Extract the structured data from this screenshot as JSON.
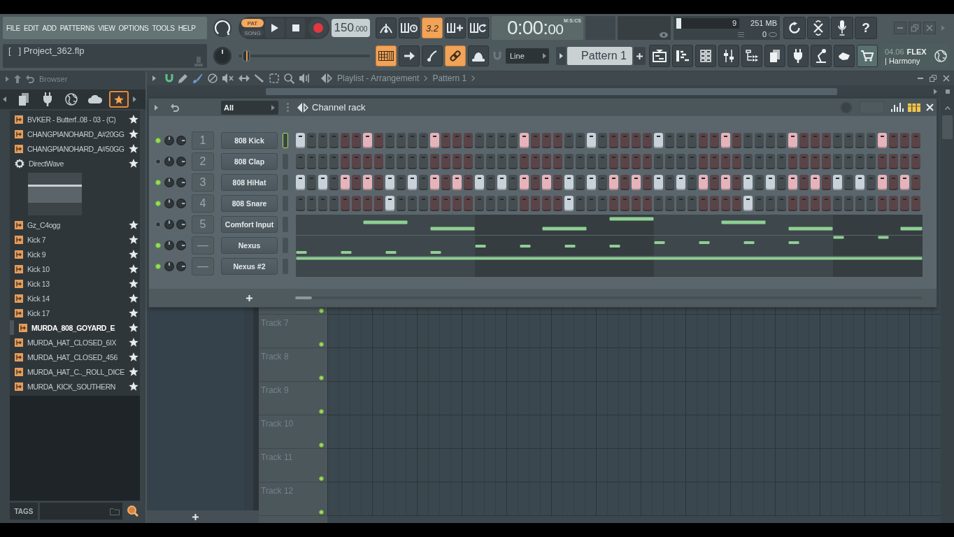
{
  "menu": [
    "FILE",
    "EDIT",
    "ADD",
    "PATTERNS",
    "VIEW",
    "OPTIONS",
    "TOOLS",
    "HELP"
  ],
  "project": {
    "title": "[   ] Project_362.flp"
  },
  "transport": {
    "modes": [
      {
        "label": "PAT",
        "selected": true
      },
      {
        "label": "SONG",
        "selected": false
      }
    ]
  },
  "tempo": {
    "whole": "150",
    "fraction": ".000"
  },
  "record_options": [
    {
      "kind": "metronome",
      "on": false
    },
    {
      "kind": "wait",
      "on": false
    },
    {
      "kind": "countdown",
      "label": "3.2",
      "on": true
    },
    {
      "kind": "stepedit",
      "on": false
    },
    {
      "kind": "loop",
      "on": false
    }
  ],
  "time": {
    "value": "0:00:",
    "centiseconds": "00",
    "unit": "M:S:CS"
  },
  "monitor": {
    "cpu": {
      "level": 0.08,
      "reading": "9"
    },
    "memory": "251 MB",
    "polyphony": "0"
  },
  "help": {
    "label": "?"
  },
  "master_pitch": {
    "level": 0.06
  },
  "edit_options": [
    {
      "kind": "keyboard",
      "on": true
    },
    {
      "kind": "arrow",
      "on": false
    },
    {
      "kind": "curve",
      "on": false
    },
    {
      "kind": "link",
      "on": true
    },
    {
      "kind": "dome",
      "on": false
    }
  ],
  "snap": {
    "value": "Line"
  },
  "pattern": {
    "value": "Pattern 1"
  },
  "news": {
    "date": "04.06",
    "title": "FLEX",
    "subtitle": "| Harmony"
  },
  "browser": {
    "title": "Browser",
    "tabs": [
      {
        "kind": "files",
        "selected": false
      },
      {
        "kind": "plugins",
        "selected": false
      },
      {
        "kind": "web",
        "selected": false
      },
      {
        "kind": "cloud",
        "selected": false
      },
      {
        "kind": "favorites",
        "selected": true
      }
    ],
    "items": [
      {
        "kind": "audio",
        "label": "BVKER - Butterf..08 - 03 - (C)",
        "starred": true,
        "selected": false
      },
      {
        "kind": "audio",
        "label": "CHANGPIANOHARD_A#20GG",
        "starred": true,
        "selected": false
      },
      {
        "kind": "audio",
        "label": "CHANGPIANOHARD_A#50GG",
        "starred": true,
        "selected": false
      },
      {
        "kind": "plugin",
        "label": "DirectWave",
        "starred": true,
        "selected": false,
        "thumbnail": true
      },
      {
        "kind": "audio",
        "label": "Gz_C4ogg",
        "starred": true,
        "selected": false
      },
      {
        "kind": "audio",
        "label": "Kick 7",
        "starred": true,
        "selected": false
      },
      {
        "kind": "audio",
        "label": "Kick 9",
        "starred": true,
        "selected": false
      },
      {
        "kind": "audio",
        "label": "Kick 10",
        "starred": true,
        "selected": false
      },
      {
        "kind": "audio",
        "label": "Kick 13",
        "starred": true,
        "selected": false
      },
      {
        "kind": "audio",
        "label": "Kick 14",
        "starred": true,
        "selected": false
      },
      {
        "kind": "audio",
        "label": "Kick 17",
        "starred": true,
        "selected": false
      },
      {
        "kind": "audio",
        "label": "MURDA_808_GOYARD_E",
        "starred": true,
        "selected": true
      },
      {
        "kind": "audio",
        "label": "MURDA_HAT_CLOSED_6IX",
        "starred": true,
        "selected": false
      },
      {
        "kind": "audio",
        "label": "MURDA_HAT_CLOSED_456",
        "starred": true,
        "selected": false
      },
      {
        "kind": "audio",
        "label": "MURDA_HAT_C.._ROLL_DICE",
        "starred": true,
        "selected": false
      },
      {
        "kind": "audio",
        "label": "MURDA_KICK_SOUTHERN",
        "starred": true,
        "selected": false
      }
    ],
    "tags": "TAGS"
  },
  "playlist": {
    "title": "Playlist - Arrangement",
    "pattern": "Pattern 1",
    "tracks": [
      {
        "on": true
      },
      {
        "label": "Track 7",
        "on": true
      },
      {
        "label": "Track 8",
        "on": true
      },
      {
        "label": "Track 9",
        "on": true
      },
      {
        "label": "Track 10",
        "on": true
      },
      {
        "label": "Track 11",
        "on": true
      },
      {
        "label": "Track 12",
        "on": true
      }
    ]
  },
  "channel_rack": {
    "title": "Channel rack",
    "filter": "All",
    "channels": [
      {
        "kind": "steps",
        "number": "1",
        "name": "808 Kick",
        "on": true,
        "selected": true,
        "steps": [
          {
            "on": true
          },
          {
            "on": false
          },
          {
            "on": false
          },
          {
            "on": false
          },
          {
            "on": false
          },
          {
            "on": false
          },
          {
            "on": true
          },
          {
            "on": false
          },
          {
            "on": false
          },
          {
            "on": false
          },
          {
            "on": false
          },
          {
            "on": false
          },
          {
            "on": true
          },
          {
            "on": false
          },
          {
            "on": false
          },
          {
            "on": false
          },
          {
            "on": false
          },
          {
            "on": false
          },
          {
            "on": false
          },
          {
            "on": false
          },
          {
            "on": true
          },
          {
            "on": false
          },
          {
            "on": false
          },
          {
            "on": false
          },
          {
            "on": false
          },
          {
            "on": false
          },
          {
            "on": true
          },
          {
            "on": false
          },
          {
            "on": false
          },
          {
            "on": false
          },
          {
            "on": false
          },
          {
            "on": false
          },
          {
            "on": true
          },
          {
            "on": false
          },
          {
            "on": false
          },
          {
            "on": false
          },
          {
            "on": false
          },
          {
            "on": false
          },
          {
            "on": true
          },
          {
            "on": false
          },
          {
            "on": false
          },
          {
            "on": false
          },
          {
            "on": false
          },
          {
            "on": false
          },
          {
            "on": true
          },
          {
            "on": false
          },
          {
            "on": false
          },
          {
            "on": false
          },
          {
            "on": false
          },
          {
            "on": false
          },
          {
            "on": false
          },
          {
            "on": false
          },
          {
            "on": true
          },
          {
            "on": false
          },
          {
            "on": false
          },
          {
            "on": false
          }
        ]
      },
      {
        "kind": "steps",
        "number": "2",
        "name": "808 Clap",
        "on": false,
        "selected": false,
        "steps": [
          {
            "on": false
          },
          {
            "on": false
          },
          {
            "on": false
          },
          {
            "on": false
          },
          {
            "on": false
          },
          {
            "on": false
          },
          {
            "on": false
          },
          {
            "on": false
          },
          {
            "on": false
          },
          {
            "on": false
          },
          {
            "on": false
          },
          {
            "on": false
          },
          {
            "on": false
          },
          {
            "on": false
          },
          {
            "on": false
          },
          {
            "on": false
          },
          {
            "on": false
          },
          {
            "on": false
          },
          {
            "on": false
          },
          {
            "on": false
          },
          {
            "on": false
          },
          {
            "on": false
          },
          {
            "on": false
          },
          {
            "on": false
          },
          {
            "on": false
          },
          {
            "on": false
          },
          {
            "on": false
          },
          {
            "on": false
          },
          {
            "on": false
          },
          {
            "on": false
          },
          {
            "on": false
          },
          {
            "on": false
          },
          {
            "on": false
          },
          {
            "on": false
          },
          {
            "on": false
          },
          {
            "on": false
          },
          {
            "on": false
          },
          {
            "on": false
          },
          {
            "on": false
          },
          {
            "on": false
          },
          {
            "on": false
          },
          {
            "on": false
          },
          {
            "on": false
          },
          {
            "on": false
          },
          {
            "on": false
          },
          {
            "on": false
          },
          {
            "on": false
          },
          {
            "on": false
          },
          {
            "on": false
          },
          {
            "on": false
          },
          {
            "on": false
          },
          {
            "on": false
          },
          {
            "on": false
          },
          {
            "on": false
          },
          {
            "on": false
          },
          {
            "on": false
          }
        ]
      },
      {
        "kind": "steps",
        "number": "3",
        "name": "808 HiHat",
        "on": true,
        "selected": false,
        "steps": [
          {
            "on": true
          },
          {
            "on": false
          },
          {
            "on": true
          },
          {
            "on": false
          },
          {
            "on": true
          },
          {
            "on": false
          },
          {
            "on": true
          },
          {
            "on": false
          },
          {
            "on": true
          },
          {
            "on": false
          },
          {
            "on": true
          },
          {
            "on": false
          },
          {
            "on": true
          },
          {
            "on": false
          },
          {
            "on": true
          },
          {
            "on": false
          },
          {
            "on": true
          },
          {
            "on": false
          },
          {
            "on": true
          },
          {
            "on": false
          },
          {
            "on": true
          },
          {
            "on": false
          },
          {
            "on": true
          },
          {
            "on": false
          },
          {
            "on": true
          },
          {
            "on": false
          },
          {
            "on": true
          },
          {
            "on": false
          },
          {
            "on": true
          },
          {
            "on": false
          },
          {
            "on": true
          },
          {
            "on": false
          },
          {
            "on": true
          },
          {
            "on": false
          },
          {
            "on": true
          },
          {
            "on": false
          },
          {
            "on": true
          },
          {
            "on": false
          },
          {
            "on": true
          },
          {
            "on": false
          },
          {
            "on": true
          },
          {
            "on": false
          },
          {
            "on": true
          },
          {
            "on": false
          },
          {
            "on": true
          },
          {
            "on": false
          },
          {
            "on": true
          },
          {
            "on": false
          },
          {
            "on": true
          },
          {
            "on": false
          },
          {
            "on": true
          },
          {
            "on": false
          },
          {
            "on": true
          },
          {
            "on": false
          },
          {
            "on": true
          },
          {
            "on": false
          }
        ]
      },
      {
        "kind": "steps",
        "number": "4",
        "name": "808 Snare",
        "on": true,
        "selected": false,
        "steps": [
          {
            "on": false
          },
          {
            "on": false
          },
          {
            "on": false
          },
          {
            "on": false
          },
          {
            "on": false
          },
          {
            "on": false
          },
          {
            "on": false
          },
          {
            "on": false
          },
          {
            "on": true
          },
          {
            "on": false
          },
          {
            "on": false
          },
          {
            "on": false
          },
          {
            "on": false
          },
          {
            "on": false
          },
          {
            "on": false
          },
          {
            "on": false
          },
          {
            "on": false
          },
          {
            "on": false
          },
          {
            "on": false
          },
          {
            "on": false
          },
          {
            "on": false
          },
          {
            "on": false
          },
          {
            "on": false
          },
          {
            "on": false
          },
          {
            "on": true
          },
          {
            "on": false
          },
          {
            "on": false
          },
          {
            "on": false
          },
          {
            "on": false
          },
          {
            "on": false
          },
          {
            "on": false
          },
          {
            "on": false
          },
          {
            "on": false
          },
          {
            "on": false
          },
          {
            "on": false
          },
          {
            "on": false
          },
          {
            "on": false
          },
          {
            "on": false
          },
          {
            "on": false
          },
          {
            "on": false
          },
          {
            "on": true
          },
          {
            "on": false
          },
          {
            "on": false
          },
          {
            "on": false
          },
          {
            "on": false
          },
          {
            "on": false
          },
          {
            "on": false
          },
          {
            "on": false
          },
          {
            "on": false
          },
          {
            "on": false
          },
          {
            "on": false
          },
          {
            "on": false
          },
          {
            "on": false
          },
          {
            "on": false
          },
          {
            "on": false
          },
          {
            "on": false
          }
        ]
      },
      {
        "kind": "notes",
        "number": "5",
        "name": "Comfort Input",
        "on": false,
        "selected": false
      },
      {
        "kind": "notes",
        "number": "—",
        "name": "Nexus",
        "on": true,
        "selected": false
      },
      {
        "kind": "notes",
        "number": "—",
        "name": "Nexus #2",
        "on": true,
        "selected": false
      }
    ]
  }
}
